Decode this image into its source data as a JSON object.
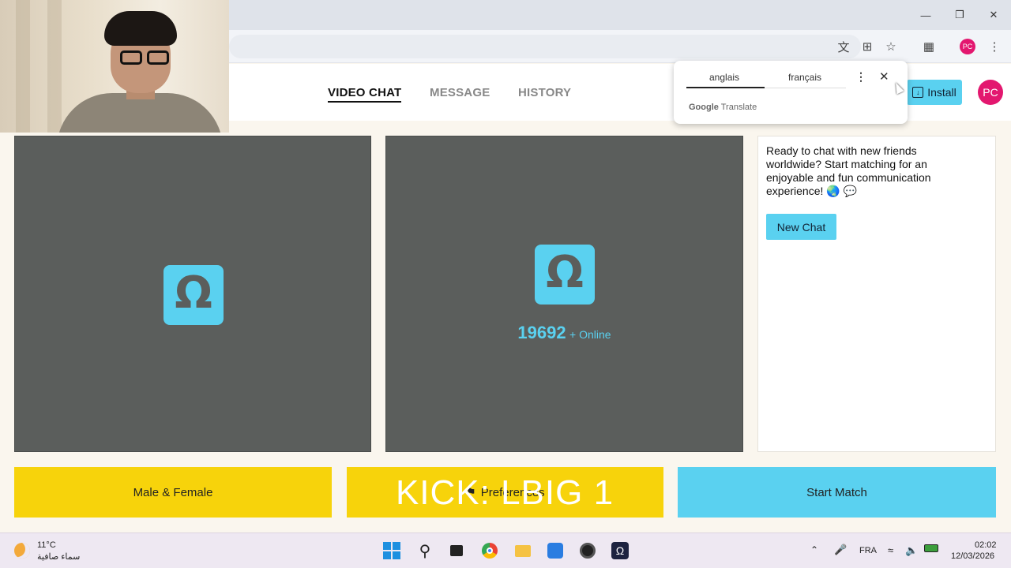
{
  "nav": {
    "tabs": [
      {
        "label": "VIDEO CHAT",
        "active": true
      },
      {
        "label": "MESSAGE",
        "active": false
      },
      {
        "label": "HISTORY",
        "active": false
      }
    ],
    "install_label": "Install",
    "avatar_initials": "PC"
  },
  "browser": {
    "profile_initials": "PC",
    "icons": [
      "translate-icon",
      "install-app-icon",
      "bookmark-star-icon",
      "extensions-icon",
      "kebab-menu-icon"
    ]
  },
  "translate_popup": {
    "source_lang": "anglais",
    "target_lang": "français",
    "brand_google": "Google",
    "brand_translate": "Translate"
  },
  "video": {
    "online_count": "19692",
    "online_label": "+ Online"
  },
  "info": {
    "message": "Ready to chat with new friends worldwide? Start matching for an enjoyable and fun communication experience! 🌏 💬",
    "new_chat_label": "New Chat"
  },
  "actions": {
    "gender_label": "Male & Female",
    "preferences_label": "Preferences",
    "start_label": "Start Match"
  },
  "overlay_text": "KICK: LBIG  1",
  "taskbar": {
    "temperature": "11°C",
    "weather": "سماء صافية",
    "language": "FRA",
    "time": "02:02",
    "date": "12/03/2026"
  },
  "colors": {
    "accent_cyan": "#5ad1f0",
    "yellow": "#f7d30b",
    "panel_gray": "#5b5e5c",
    "avatar_pink": "#e3176f"
  }
}
